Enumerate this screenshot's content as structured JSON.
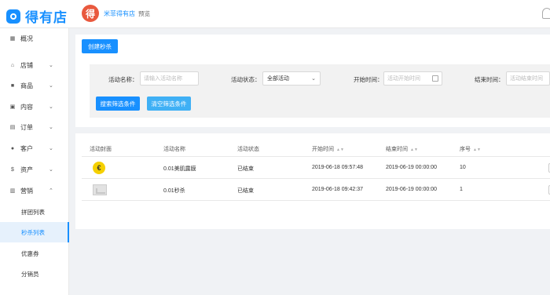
{
  "app": {
    "logo_text": "得有店",
    "shop_avatar_char": "得",
    "shop_name": "米菲得有店",
    "preview_label": "预览"
  },
  "sidebar": {
    "items": [
      {
        "icon": "grid-icon",
        "glyph": "▦",
        "label": "概况"
      },
      {
        "icon": "shop-icon",
        "glyph": "⌂",
        "label": "店铺"
      },
      {
        "icon": "goods-icon",
        "glyph": "■",
        "label": "商品"
      },
      {
        "icon": "content-icon",
        "glyph": "▣",
        "label": "内容"
      },
      {
        "icon": "order-icon",
        "glyph": "▤",
        "label": "订单"
      },
      {
        "icon": "customer-icon",
        "glyph": "●",
        "label": "客户"
      },
      {
        "icon": "asset-icon",
        "glyph": "$",
        "label": "资产"
      },
      {
        "icon": "marketing-icon",
        "glyph": "▥",
        "label": "营销"
      }
    ],
    "sub_items": [
      "拼团列表",
      "秒杀列表",
      "优惠券",
      "分销员"
    ]
  },
  "toolbar": {
    "create_label": "创建秒杀"
  },
  "filter": {
    "name_label": "活动名称：",
    "name_placeholder": "请输入活动名称",
    "status_label": "活动状态：",
    "status_value": "全部活动",
    "start_label": "开始时间：",
    "start_placeholder": "活动开始时间",
    "end_label": "结束时间：",
    "end_placeholder": "活动结束时间",
    "search_label": "搜索筛选条件",
    "clear_label": "清空筛选条件"
  },
  "table": {
    "headers": [
      "活动封面",
      "活动名称",
      "活动状态",
      "开始时间",
      "结束时间",
      "序号"
    ],
    "rows": [
      {
        "name": "0.01美肌露膜",
        "status": "已结束",
        "start": "2019-06-18 09:57:48",
        "end": "2019-06-19 00:00:00",
        "index": "10"
      },
      {
        "name": "0.01秒杀",
        "status": "已结束",
        "start": "2019-06-18 09:42:37",
        "end": "2019-06-19 00:00:00",
        "index": "1"
      }
    ]
  },
  "colors": {
    "accent": "#1890ff",
    "active_bg": "#e6f1fc",
    "coin": "#f5d000"
  }
}
